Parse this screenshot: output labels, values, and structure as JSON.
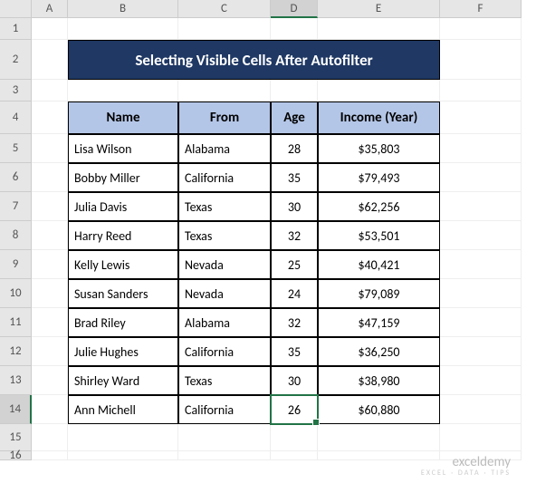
{
  "columns": [
    "A",
    "B",
    "C",
    "D",
    "E",
    "F"
  ],
  "rows_visible": [
    1,
    2,
    3,
    4,
    5,
    6,
    7,
    8,
    9,
    10,
    11,
    12,
    13,
    14,
    15,
    16
  ],
  "selected_col": "D",
  "selected_row": 14,
  "title": "Selecting Visible Cells After Autofilter",
  "headers": {
    "name": "Name",
    "from": "From",
    "age": "Age",
    "income": "Income (Year)"
  },
  "chart_data": {
    "type": "table",
    "columns": [
      "Name",
      "From",
      "Age",
      "Income (Year)"
    ],
    "rows": [
      {
        "name": "Lisa Wilson",
        "from": "Alabama",
        "age": 28,
        "income": "$35,803"
      },
      {
        "name": "Bobby Miller",
        "from": "California",
        "age": 35,
        "income": "$79,493"
      },
      {
        "name": "Julia Davis",
        "from": "Texas",
        "age": 30,
        "income": "$62,256"
      },
      {
        "name": "Harry Reed",
        "from": "Texas",
        "age": 32,
        "income": "$53,501"
      },
      {
        "name": "Kelly Lewis",
        "from": "Nevada",
        "age": 25,
        "income": "$40,421"
      },
      {
        "name": "Susan Sanders",
        "from": "Nevada",
        "age": 24,
        "income": "$79,089"
      },
      {
        "name": "Brad Riley",
        "from": "Alabama",
        "age": 32,
        "income": "$47,159"
      },
      {
        "name": "Julie Hughes",
        "from": "California",
        "age": 35,
        "income": "$36,250"
      },
      {
        "name": "Shirley Ward",
        "from": "Texas",
        "age": 30,
        "income": "$38,980"
      },
      {
        "name": "Ann Michell",
        "from": "California",
        "age": 26,
        "income": "$60,880"
      }
    ]
  },
  "watermark": {
    "main": "exceldemy",
    "sub": "EXCEL · DATA · TIPS"
  }
}
